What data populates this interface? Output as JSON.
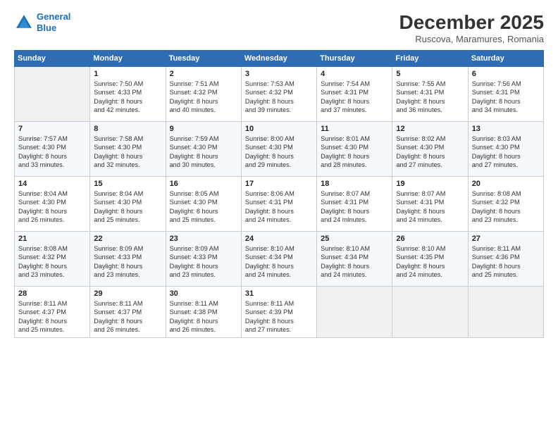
{
  "logo": {
    "line1": "General",
    "line2": "Blue"
  },
  "title": "December 2025",
  "subtitle": "Ruscova, Maramures, Romania",
  "days_of_week": [
    "Sunday",
    "Monday",
    "Tuesday",
    "Wednesday",
    "Thursday",
    "Friday",
    "Saturday"
  ],
  "weeks": [
    [
      {
        "num": "",
        "info": ""
      },
      {
        "num": "1",
        "info": "Sunrise: 7:50 AM\nSunset: 4:33 PM\nDaylight: 8 hours\nand 42 minutes."
      },
      {
        "num": "2",
        "info": "Sunrise: 7:51 AM\nSunset: 4:32 PM\nDaylight: 8 hours\nand 40 minutes."
      },
      {
        "num": "3",
        "info": "Sunrise: 7:53 AM\nSunset: 4:32 PM\nDaylight: 8 hours\nand 39 minutes."
      },
      {
        "num": "4",
        "info": "Sunrise: 7:54 AM\nSunset: 4:31 PM\nDaylight: 8 hours\nand 37 minutes."
      },
      {
        "num": "5",
        "info": "Sunrise: 7:55 AM\nSunset: 4:31 PM\nDaylight: 8 hours\nand 36 minutes."
      },
      {
        "num": "6",
        "info": "Sunrise: 7:56 AM\nSunset: 4:31 PM\nDaylight: 8 hours\nand 34 minutes."
      }
    ],
    [
      {
        "num": "7",
        "info": "Sunrise: 7:57 AM\nSunset: 4:30 PM\nDaylight: 8 hours\nand 33 minutes."
      },
      {
        "num": "8",
        "info": "Sunrise: 7:58 AM\nSunset: 4:30 PM\nDaylight: 8 hours\nand 32 minutes."
      },
      {
        "num": "9",
        "info": "Sunrise: 7:59 AM\nSunset: 4:30 PM\nDaylight: 8 hours\nand 30 minutes."
      },
      {
        "num": "10",
        "info": "Sunrise: 8:00 AM\nSunset: 4:30 PM\nDaylight: 8 hours\nand 29 minutes."
      },
      {
        "num": "11",
        "info": "Sunrise: 8:01 AM\nSunset: 4:30 PM\nDaylight: 8 hours\nand 28 minutes."
      },
      {
        "num": "12",
        "info": "Sunrise: 8:02 AM\nSunset: 4:30 PM\nDaylight: 8 hours\nand 27 minutes."
      },
      {
        "num": "13",
        "info": "Sunrise: 8:03 AM\nSunset: 4:30 PM\nDaylight: 8 hours\nand 27 minutes."
      }
    ],
    [
      {
        "num": "14",
        "info": "Sunrise: 8:04 AM\nSunset: 4:30 PM\nDaylight: 8 hours\nand 26 minutes."
      },
      {
        "num": "15",
        "info": "Sunrise: 8:04 AM\nSunset: 4:30 PM\nDaylight: 8 hours\nand 25 minutes."
      },
      {
        "num": "16",
        "info": "Sunrise: 8:05 AM\nSunset: 4:30 PM\nDaylight: 8 hours\nand 25 minutes."
      },
      {
        "num": "17",
        "info": "Sunrise: 8:06 AM\nSunset: 4:31 PM\nDaylight: 8 hours\nand 24 minutes."
      },
      {
        "num": "18",
        "info": "Sunrise: 8:07 AM\nSunset: 4:31 PM\nDaylight: 8 hours\nand 24 minutes."
      },
      {
        "num": "19",
        "info": "Sunrise: 8:07 AM\nSunset: 4:31 PM\nDaylight: 8 hours\nand 24 minutes."
      },
      {
        "num": "20",
        "info": "Sunrise: 8:08 AM\nSunset: 4:32 PM\nDaylight: 8 hours\nand 23 minutes."
      }
    ],
    [
      {
        "num": "21",
        "info": "Sunrise: 8:08 AM\nSunset: 4:32 PM\nDaylight: 8 hours\nand 23 minutes."
      },
      {
        "num": "22",
        "info": "Sunrise: 8:09 AM\nSunset: 4:33 PM\nDaylight: 8 hours\nand 23 minutes."
      },
      {
        "num": "23",
        "info": "Sunrise: 8:09 AM\nSunset: 4:33 PM\nDaylight: 8 hours\nand 23 minutes."
      },
      {
        "num": "24",
        "info": "Sunrise: 8:10 AM\nSunset: 4:34 PM\nDaylight: 8 hours\nand 24 minutes."
      },
      {
        "num": "25",
        "info": "Sunrise: 8:10 AM\nSunset: 4:34 PM\nDaylight: 8 hours\nand 24 minutes."
      },
      {
        "num": "26",
        "info": "Sunrise: 8:10 AM\nSunset: 4:35 PM\nDaylight: 8 hours\nand 24 minutes."
      },
      {
        "num": "27",
        "info": "Sunrise: 8:11 AM\nSunset: 4:36 PM\nDaylight: 8 hours\nand 25 minutes."
      }
    ],
    [
      {
        "num": "28",
        "info": "Sunrise: 8:11 AM\nSunset: 4:37 PM\nDaylight: 8 hours\nand 25 minutes."
      },
      {
        "num": "29",
        "info": "Sunrise: 8:11 AM\nSunset: 4:37 PM\nDaylight: 8 hours\nand 26 minutes."
      },
      {
        "num": "30",
        "info": "Sunrise: 8:11 AM\nSunset: 4:38 PM\nDaylight: 8 hours\nand 26 minutes."
      },
      {
        "num": "31",
        "info": "Sunrise: 8:11 AM\nSunset: 4:39 PM\nDaylight: 8 hours\nand 27 minutes."
      },
      {
        "num": "",
        "info": ""
      },
      {
        "num": "",
        "info": ""
      },
      {
        "num": "",
        "info": ""
      }
    ]
  ]
}
